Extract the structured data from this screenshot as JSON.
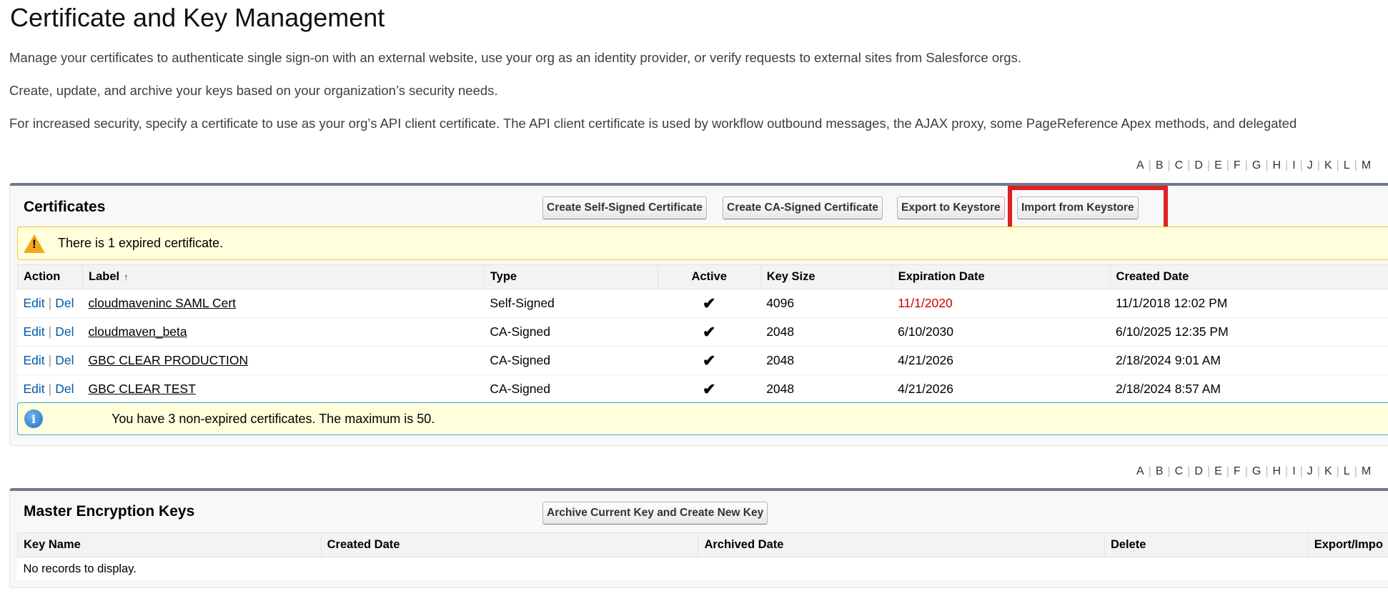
{
  "page": {
    "title": "Certificate and Key Management",
    "intro": [
      "Manage your certificates to authenticate single sign-on with an external website, use your org as an identity provider, or verify requests to external sites from Salesforce orgs.",
      "Create, update, and archive your keys based on your organization’s security needs.",
      "For increased security, specify a certificate to use as your org’s API client certificate. The API client certificate is used by workflow outbound messages, the AJAX proxy, some PageReference Apex methods, and delegated"
    ]
  },
  "alphabet": [
    "A",
    "B",
    "C",
    "D",
    "E",
    "F",
    "G",
    "H",
    "I",
    "J",
    "K",
    "L",
    "M"
  ],
  "certificates": {
    "title": "Certificates",
    "buttons": {
      "self_signed": "Create Self-Signed Certificate",
      "ca_signed": "Create CA-Signed Certificate",
      "export": "Export to Keystore",
      "import": "Import from Keystore"
    },
    "warning": "There is 1 expired certificate.",
    "columns": {
      "action": "Action",
      "label": "Label",
      "sort_icon": "↑",
      "type": "Type",
      "active": "Active",
      "key_size": "Key Size",
      "expiration": "Expiration Date",
      "created": "Created Date"
    },
    "action_labels": {
      "edit": "Edit",
      "del": "Del",
      "sep": "|"
    },
    "check_mark": "✔",
    "rows": [
      {
        "label": "cloudmaveninc SAML Cert",
        "type": "Self-Signed",
        "key_size": "4096",
        "expiration": "11/1/2020",
        "created": "11/1/2018 12:02 PM"
      },
      {
        "label": "cloudmaven_beta",
        "type": "CA-Signed",
        "key_size": "2048",
        "expiration": "6/10/2030",
        "created": "6/10/2025 12:35 PM"
      },
      {
        "label": "GBC CLEAR PRODUCTION",
        "type": "CA-Signed",
        "key_size": "2048",
        "expiration": "4/21/2026",
        "created": "2/18/2024 9:01 AM"
      },
      {
        "label": "GBC CLEAR TEST",
        "type": "CA-Signed",
        "key_size": "2048",
        "expiration": "4/21/2026",
        "created": "2/18/2024 8:57 AM"
      }
    ],
    "info": "You have 3 non-expired certificates. The maximum is 50.",
    "info_icon": "i",
    "expired_color": "#c00000"
  },
  "master_keys": {
    "title": "Master Encryption Keys",
    "button": "Archive Current Key and Create New Key",
    "columns": {
      "key_name": "Key Name",
      "created": "Created Date",
      "archived": "Archived Date",
      "delete": "Delete",
      "export_import": "Export/Impo"
    },
    "empty": "No records to display."
  }
}
